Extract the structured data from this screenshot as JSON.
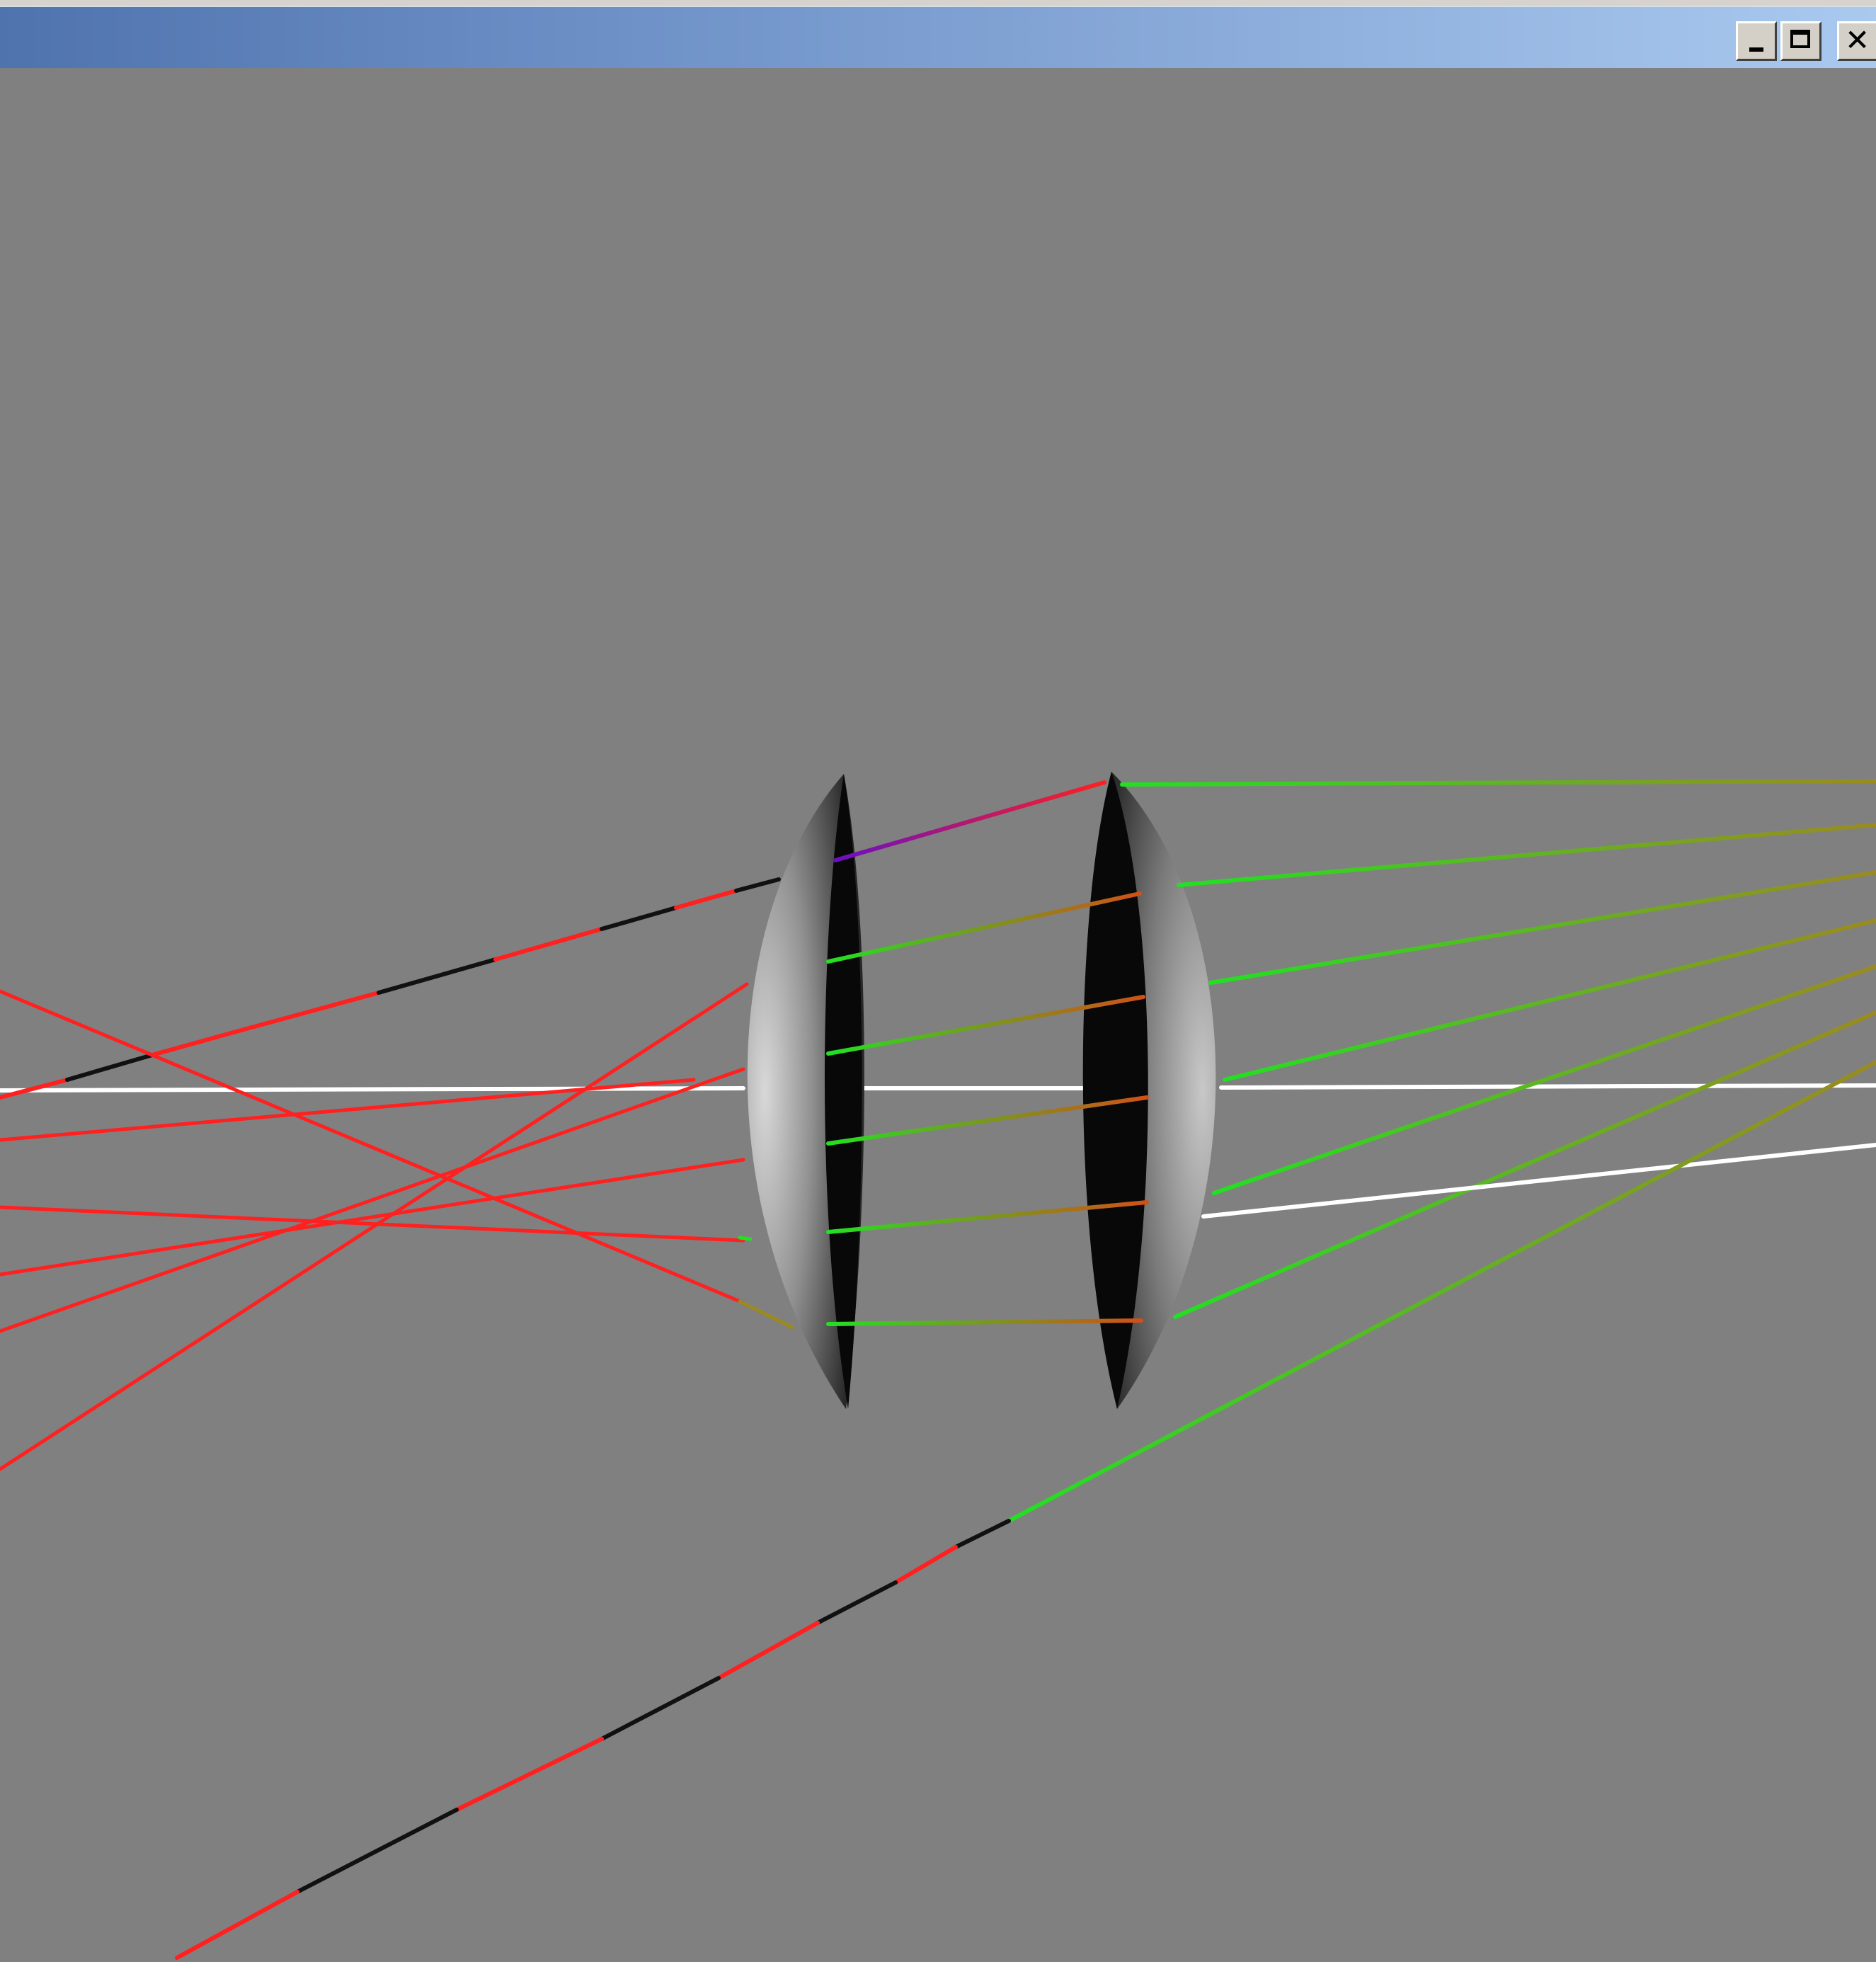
{
  "window": {
    "title": "",
    "controls": {
      "minimize_icon": "minimize-icon",
      "maximize_icon": "maximize-icon",
      "close_icon": "close-icon",
      "close_glyph": "✕"
    }
  },
  "scene": {
    "background": "#808080",
    "lens_dark": "#080808",
    "lens_highlight": "#c8c8c8",
    "axis_color": "#ffffff",
    "ray_colors": {
      "red": "#ff2020",
      "black": "#111111",
      "green": "#22e022",
      "olive": "#9a8a20",
      "orange": "#d05018",
      "purple": "#6a10c0",
      "white": "#ffffff"
    }
  }
}
